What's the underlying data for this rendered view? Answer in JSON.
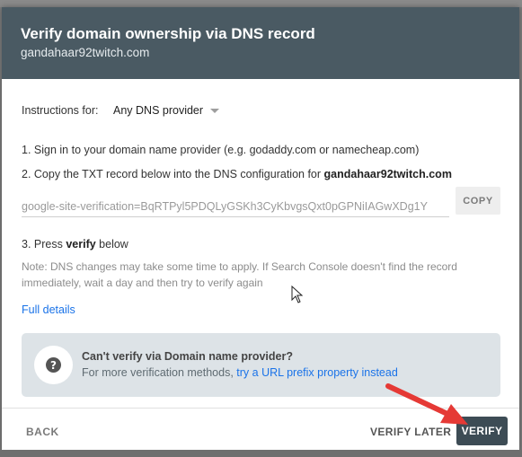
{
  "dialog": {
    "title": "Verify domain ownership via DNS record",
    "subtitle": "gandahaar92twitch.com"
  },
  "instructions": {
    "label": "Instructions for:",
    "provider": "Any DNS provider",
    "step1": "1. Sign in to your domain name provider (e.g. godaddy.com or namecheap.com)",
    "step2_prefix": "2. Copy the TXT record below into the DNS configuration for ",
    "step2_domain": "gandahaar92twitch.com",
    "txt_record": "google-site-verification=BqRTPyl5PDQLyGSKh3CyKbvgsQxt0pGPNiIAGwXDg1Y",
    "copy_label": "COPY",
    "step3_prefix": "3. Press ",
    "step3_bold": "verify",
    "step3_suffix": " below",
    "note": "Note: DNS changes may take some time to apply. If Search Console doesn't find the record immediately, wait a day and then try to verify again",
    "full_details": "Full details"
  },
  "info_box": {
    "title": "Can't verify via Domain name provider?",
    "text_prefix": "For more verification methods, ",
    "link": "try a URL prefix property instead",
    "icon": "help-icon"
  },
  "footer": {
    "back": "BACK",
    "verify_later": "VERIFY LATER",
    "verify": "VERIFY"
  },
  "colors": {
    "header_bg": "#4a5a63",
    "link": "#1a73e8",
    "verify_bg": "#3d4c55",
    "annotation_arrow": "#e53935"
  }
}
